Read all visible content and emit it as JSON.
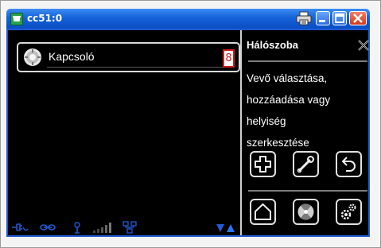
{
  "window": {
    "title": "cc51:0",
    "icons": {
      "app": "phone-icon",
      "print": "printer-icon",
      "minimize": "minimize-icon",
      "maximize": "maximize-icon",
      "close": "close-icon"
    },
    "colors": {
      "titlebar": "#1462d9",
      "close": "#d2391a",
      "screen": "#000000"
    }
  },
  "device_list": {
    "items": [
      {
        "label": "Kapcsoló",
        "badge": "8",
        "icon": "switch-icon"
      }
    ]
  },
  "side_panel": {
    "title": "Hálószoba",
    "close_icon": "close-x-icon",
    "description": "Vevő választása, hozzáadása vagy helyiség szerkesztése",
    "description_lines": [
      "Vevő választása,",
      "hozzáadása vagy",
      "helyiség",
      "szerkesztése"
    ],
    "buttons_row1": [
      {
        "name": "add-button",
        "icon": "plus-icon"
      },
      {
        "name": "edit-button",
        "icon": "wrench-icon"
      },
      {
        "name": "back-button",
        "icon": "undo-icon"
      }
    ],
    "buttons_row2": [
      {
        "name": "home-button",
        "icon": "home-icon"
      },
      {
        "name": "fan-button",
        "icon": "fan-icon"
      },
      {
        "name": "settings-button",
        "icon": "gears-icon"
      }
    ]
  },
  "status_bar": {
    "icons": [
      "plug-icon",
      "link-icon",
      "antenna-icon",
      "signal-bars-icon",
      "network-icon",
      "scroll-arrows-icon"
    ],
    "accent": "#1f5ad2"
  }
}
